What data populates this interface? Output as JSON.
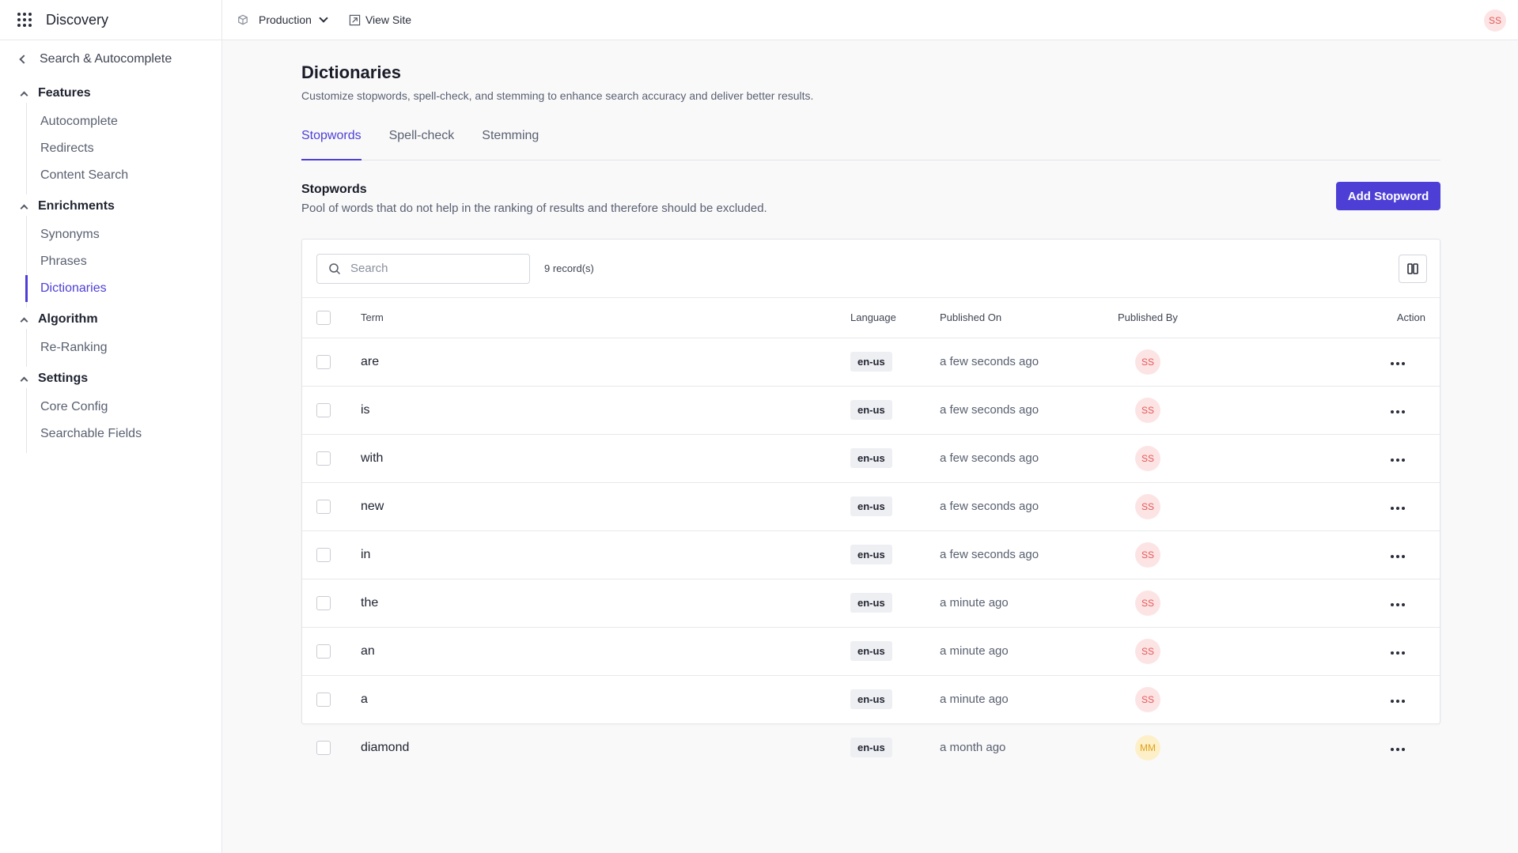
{
  "app": {
    "name": "Discovery"
  },
  "topbar": {
    "environment": "Production",
    "view_site": "View Site",
    "user_initials": "SS"
  },
  "sidebar": {
    "back_label": "Search & Autocomplete",
    "sections": [
      {
        "label": "Features",
        "items": [
          "Autocomplete",
          "Redirects",
          "Content Search"
        ]
      },
      {
        "label": "Enrichments",
        "items": [
          "Synonyms",
          "Phrases",
          "Dictionaries"
        ],
        "active": "Dictionaries"
      },
      {
        "label": "Algorithm",
        "items": [
          "Re-Ranking"
        ]
      },
      {
        "label": "Settings",
        "items": [
          "Core Config",
          "Searchable Fields"
        ]
      }
    ]
  },
  "page": {
    "title": "Dictionaries",
    "description": "Customize stopwords, spell-check, and stemming to enhance search accuracy and deliver better results.",
    "tabs": [
      {
        "label": "Stopwords",
        "active": true
      },
      {
        "label": "Spell-check",
        "active": false
      },
      {
        "label": "Stemming",
        "active": false
      }
    ],
    "section_title": "Stopwords",
    "section_description": "Pool of words that do not help in the ranking of results and therefore should be excluded.",
    "add_button": "Add Stopword"
  },
  "table": {
    "search_placeholder": "Search",
    "record_count": "9 record(s)",
    "columns": {
      "term": "Term",
      "language": "Language",
      "published_on": "Published On",
      "published_by": "Published By",
      "action": "Action"
    },
    "rows": [
      {
        "term": "are",
        "language": "en-us",
        "published_on": "a few seconds ago",
        "published_by": "SS"
      },
      {
        "term": "is",
        "language": "en-us",
        "published_on": "a few seconds ago",
        "published_by": "SS"
      },
      {
        "term": "with",
        "language": "en-us",
        "published_on": "a few seconds ago",
        "published_by": "SS"
      },
      {
        "term": "new",
        "language": "en-us",
        "published_on": "a few seconds ago",
        "published_by": "SS"
      },
      {
        "term": "in",
        "language": "en-us",
        "published_on": "a few seconds ago",
        "published_by": "SS"
      },
      {
        "term": "the",
        "language": "en-us",
        "published_on": "a minute ago",
        "published_by": "SS"
      },
      {
        "term": "an",
        "language": "en-us",
        "published_on": "a minute ago",
        "published_by": "SS"
      },
      {
        "term": "a",
        "language": "en-us",
        "published_on": "a minute ago",
        "published_by": "SS"
      },
      {
        "term": "diamond",
        "language": "en-us",
        "published_on": "a month ago",
        "published_by": "MM"
      }
    ]
  },
  "colors": {
    "accent": "#4d3fd6",
    "avatar_ss_bg": "#fde4e4",
    "avatar_ss_fg": "#e45757",
    "avatar_mm_bg": "#fdf0c8",
    "avatar_mm_fg": "#e0a21e"
  }
}
